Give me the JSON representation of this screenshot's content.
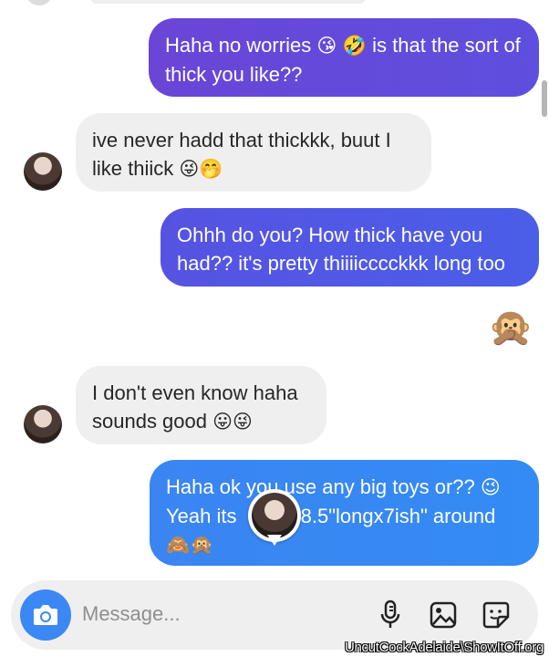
{
  "colors": {
    "outgoing_1": "#6a45d6",
    "outgoing_2": "#5b50e0",
    "outgoing_3": "#3a85f2",
    "incoming": "#efefef",
    "camera": "#3b88f5"
  },
  "messages": [
    {
      "direction": "out",
      "text": "Haha no worries",
      "emojis": "😘 🤣",
      "text2": "is that the sort of thick you like??"
    },
    {
      "direction": "in",
      "text": "ive never hadd that thickkk, buut I like thiick",
      "emojis": "😜🤭"
    },
    {
      "direction": "out",
      "text": "Ohhh do you? How thick have you had?? it's pretty thiiiicccckkk long too"
    },
    {
      "direction": "in",
      "text": "I don't even know haha sounds good",
      "emojis": "😛😜"
    },
    {
      "direction": "out",
      "text": "Haha ok you use any big toys or??",
      "emojis": "😉",
      "text2": "Yeah its",
      "text3": "8.5\"longx7ish\" around",
      "emojis2": "🙈🙊"
    }
  ],
  "reaction": {
    "emoji": "🙊"
  },
  "composer": {
    "placeholder": "Message...",
    "icons": [
      "camera-icon",
      "microphone-icon",
      "gallery-icon",
      "sticker-icon"
    ]
  },
  "watermark": "UncutCockAdelaide\\ShowItOff.org"
}
